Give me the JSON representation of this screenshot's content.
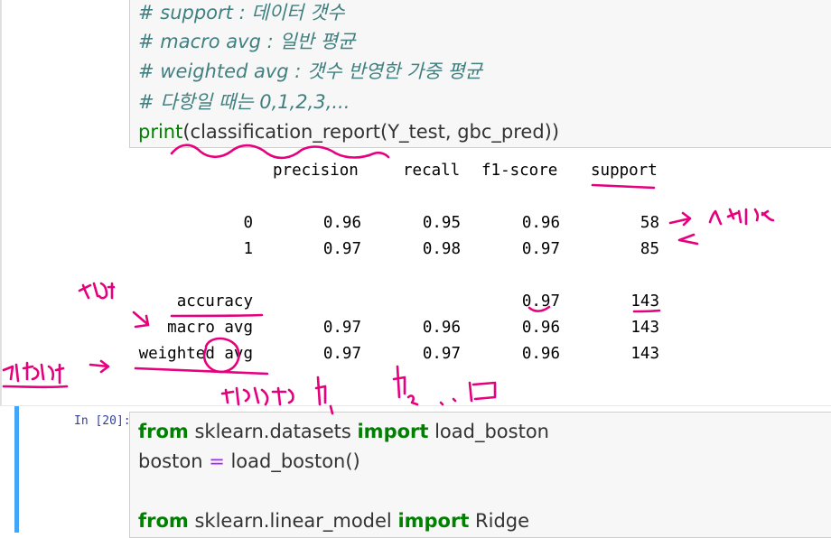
{
  "cell1": {
    "code": {
      "comment1": "# support : 데이터 갯수",
      "comment2": "# macro avg : 일반 평균",
      "comment3": "# weighted avg : 갯수 반영한 가중 평균",
      "comment4": "# 다항일 때는 0,1,2,3,...",
      "print_fn": "print",
      "print_args": "(classification_report(Y_test, gbc_pred))"
    },
    "output": {
      "headers": [
        "precision",
        "recall",
        "f1-score",
        "support"
      ],
      "rows": [
        {
          "label": "0",
          "precision": "0.96",
          "recall": "0.95",
          "f1": "0.96",
          "support": "58"
        },
        {
          "label": "1",
          "precision": "0.97",
          "recall": "0.98",
          "f1": "0.97",
          "support": "85"
        },
        {
          "label": "accuracy",
          "precision": "",
          "recall": "",
          "f1": "0.97",
          "support": "143"
        },
        {
          "label": "macro avg",
          "precision": "0.97",
          "recall": "0.96",
          "f1": "0.96",
          "support": "143"
        },
        {
          "label": "weighted avg",
          "precision": "0.97",
          "recall": "0.97",
          "f1": "0.96",
          "support": "143"
        }
      ]
    }
  },
  "cell2": {
    "prompt": "In [20]:",
    "line1": {
      "kw1": "from",
      "mod": " sklearn.datasets ",
      "kw2": "import",
      "name": " load_boston"
    },
    "line2": {
      "var": "boston ",
      "op": "=",
      "call": " load_boston()"
    },
    "line4": {
      "kw1": "from",
      "mod": " sklearn.linear_model ",
      "kw2": "import",
      "name": " Ridge"
    }
  },
  "annotations": {
    "handwriting_color": "#e6007e"
  }
}
